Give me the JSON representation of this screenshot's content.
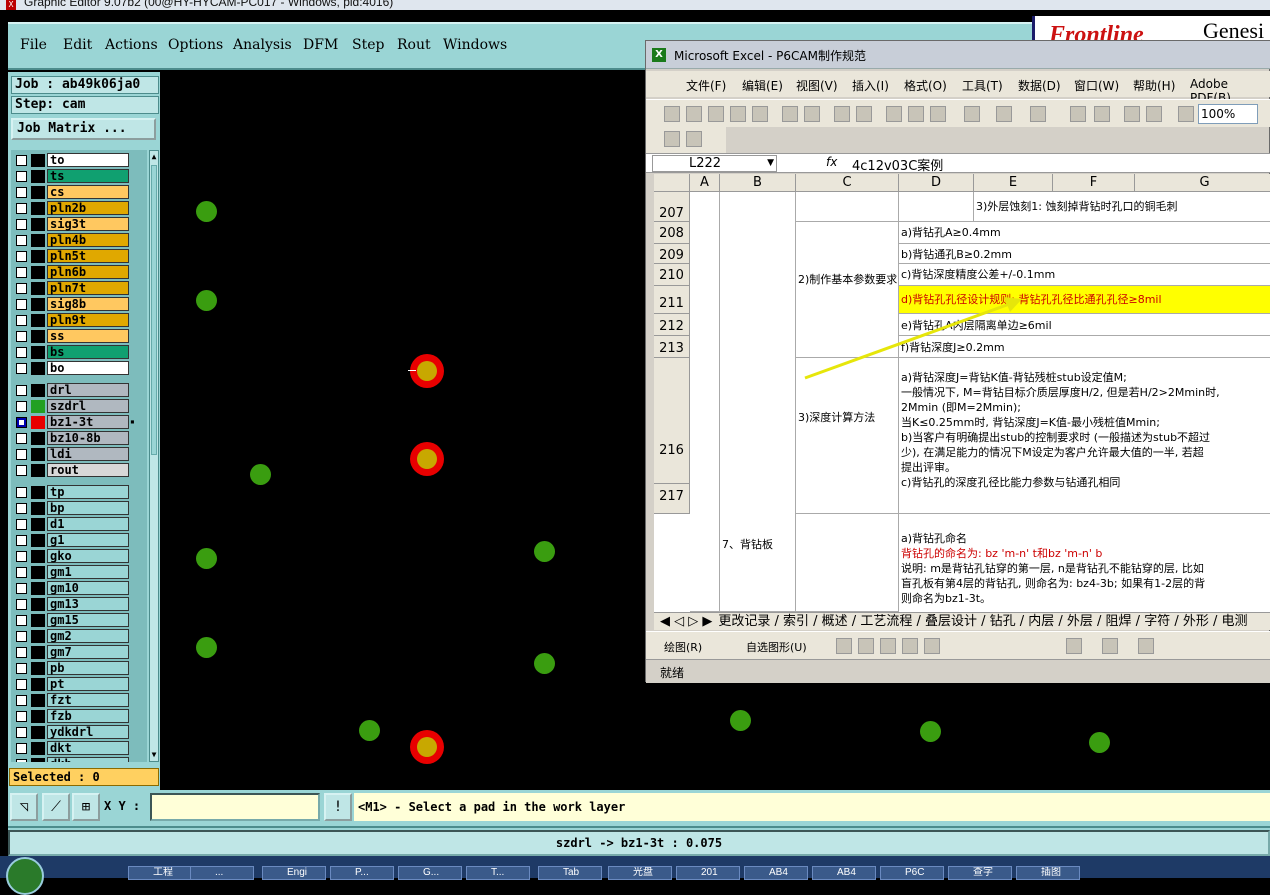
{
  "window": {
    "title": "Graphic Editor 9.07b2 (00@HY-HYCAM-PC017 - Windows, pid:4016)"
  },
  "menu": [
    "File",
    "Edit",
    "Actions",
    "Options",
    "Analysis",
    "DFM",
    "Step",
    "Rout",
    "Windows"
  ],
  "logo": {
    "brand": "Frontline",
    "product": "Genesi"
  },
  "job": {
    "job_label": "Job : ab49k06ja0",
    "step_label": "Step: cam",
    "matrix_button": "Job Matrix ..."
  },
  "layers": [
    {
      "name": "to",
      "color": "#ffffff",
      "swatch": "#000000",
      "checked": false
    },
    {
      "name": "ts",
      "color": "#10a070",
      "swatch": "#000000",
      "checked": false
    },
    {
      "name": "cs",
      "color": "#ffc860",
      "swatch": "#000000",
      "checked": false
    },
    {
      "name": "pln2b",
      "color": "#e0a800",
      "swatch": "#000000",
      "checked": false
    },
    {
      "name": "sig3t",
      "color": "#ffc860",
      "swatch": "#000000",
      "checked": false
    },
    {
      "name": "pln4b",
      "color": "#e0a800",
      "swatch": "#000000",
      "checked": false
    },
    {
      "name": "pln5t",
      "color": "#e0a800",
      "swatch": "#000000",
      "checked": false
    },
    {
      "name": "pln6b",
      "color": "#e0a800",
      "swatch": "#000000",
      "checked": false
    },
    {
      "name": "pln7t",
      "color": "#e0a800",
      "swatch": "#000000",
      "checked": false
    },
    {
      "name": "sig8b",
      "color": "#ffc860",
      "swatch": "#000000",
      "checked": false
    },
    {
      "name": "pln9t",
      "color": "#e0a800",
      "swatch": "#000000",
      "checked": false
    },
    {
      "name": "ss",
      "color": "#ffc860",
      "swatch": "#000000",
      "checked": false
    },
    {
      "name": "bs",
      "color": "#10a070",
      "swatch": "#000000",
      "checked": false
    },
    {
      "name": "bo",
      "color": "#ffffff",
      "swatch": "#000000",
      "checked": false
    },
    {
      "name": "drl",
      "color": "#b0b8c0",
      "swatch": "#000000",
      "checked": false
    },
    {
      "name": "szdrl",
      "color": "#b0b8c0",
      "swatch": "#22a022",
      "checked": false
    },
    {
      "name": "bz1-3t",
      "color": "#b0b8c0",
      "swatch": "#e80000",
      "checked": true
    },
    {
      "name": "bz10-8b",
      "color": "#b0b8c0",
      "swatch": "#000000",
      "checked": false
    },
    {
      "name": "ldi",
      "color": "#b0b8c0",
      "swatch": "#000000",
      "checked": false
    },
    {
      "name": "rout",
      "color": "#d8d8d8",
      "swatch": "#000000",
      "checked": false
    },
    {
      "name": "tp",
      "color": "#9ad5d5",
      "swatch": "#000000",
      "checked": false
    },
    {
      "name": "bp",
      "color": "#9ad5d5",
      "swatch": "#000000",
      "checked": false
    },
    {
      "name": "d1",
      "color": "#9ad5d5",
      "swatch": "#000000",
      "checked": false
    },
    {
      "name": "g1",
      "color": "#9ad5d5",
      "swatch": "#000000",
      "checked": false
    },
    {
      "name": "gko",
      "color": "#9ad5d5",
      "swatch": "#000000",
      "checked": false
    },
    {
      "name": "gm1",
      "color": "#9ad5d5",
      "swatch": "#000000",
      "checked": false
    },
    {
      "name": "gm10",
      "color": "#9ad5d5",
      "swatch": "#000000",
      "checked": false
    },
    {
      "name": "gm13",
      "color": "#9ad5d5",
      "swatch": "#000000",
      "checked": false
    },
    {
      "name": "gm15",
      "color": "#9ad5d5",
      "swatch": "#000000",
      "checked": false
    },
    {
      "name": "gm2",
      "color": "#9ad5d5",
      "swatch": "#000000",
      "checked": false
    },
    {
      "name": "gm7",
      "color": "#9ad5d5",
      "swatch": "#000000",
      "checked": false
    },
    {
      "name": "pb",
      "color": "#9ad5d5",
      "swatch": "#000000",
      "checked": false
    },
    {
      "name": "pt",
      "color": "#9ad5d5",
      "swatch": "#000000",
      "checked": false
    },
    {
      "name": "fzt",
      "color": "#9ad5d5",
      "swatch": "#000000",
      "checked": false
    },
    {
      "name": "fzb",
      "color": "#9ad5d5",
      "swatch": "#000000",
      "checked": false
    },
    {
      "name": "ydkdrl",
      "color": "#9ad5d5",
      "swatch": "#000000",
      "checked": false
    },
    {
      "name": "dkt",
      "color": "#9ad5d5",
      "swatch": "#000000",
      "checked": false
    },
    {
      "name": "dkb",
      "color": "#9ad5d5",
      "swatch": "#000000",
      "checked": false
    }
  ],
  "selected": "Selected : 0",
  "coords": {
    "xy_label": "X Y :",
    "value": ""
  },
  "prompt": "<M1> - Select a pad in the work layer",
  "status": "szdrl -> bz1-3t : 0.075",
  "excel": {
    "title": "Microsoft Excel - P6CAM制作规范",
    "menu": [
      "文件(F)",
      "编辑(E)",
      "视图(V)",
      "插入(I)",
      "格式(O)",
      "工具(T)",
      "数据(D)",
      "窗口(W)",
      "帮助(H)",
      "Adobe PDF(B)"
    ],
    "zoom": "100%",
    "namebox": "L222",
    "fx": "fx",
    "formula": "4c12v03C案例",
    "columns": [
      "A",
      "B",
      "C",
      "D",
      "E",
      "F",
      "G"
    ],
    "rows": [
      "207",
      "208",
      "209",
      "210",
      "211",
      "212",
      "213",
      "216",
      "217"
    ],
    "cells": {
      "r207": "3)外层蚀刻1: 蚀刻掉背钻时孔口的铜毛刺",
      "r208": "a)背钻孔A≥0.4mm",
      "r209": "b)背钻通孔B≥0.2mm",
      "r210": "c)背钻深度精度公差+/-0.1mm",
      "r211": "d)背钻孔孔径设计规则: 背钻孔孔径比通孔孔径≥8mil",
      "r212": "e)背钻孔A内层隔离单边≥6mil",
      "r213": "f)背钻深度J≥0.2mm",
      "c_param": "2)制作基本参数要求",
      "c_depth": "3)深度计算方法",
      "b_board": "7、背钻板",
      "depth_lines": [
        "a)背钻深度J=背钻K值-背钻残桩stub设定值M;",
        "一般情况下, M=背钻目标介质层厚度H/2, 但是若H/2>2Mmin时,",
        "2Mmin (即M=2Mmin);",
        "当K≤0.25mm时, 背钻深度J=K值-最小残桩值Mmin;",
        "b)当客户有明确提出stub的控制要求时 (一般描述为stub不超过",
        "少), 在满足能力的情况下M设定为客户允许最大值的一半, 若超",
        "提出评审。",
        "c)背钻孔的深度孔径比能力参数与钻通孔相同"
      ],
      "naming_lines": [
        "a)背钻孔命名",
        "背钻孔的命名为: bz 'm-n' t和bz 'm-n' b",
        "说明: m是背钻孔钻穿的第一层, n是背钻孔不能钻穿的层, 比如",
        "盲孔板有第4层的背钻孔, 则命名为: bz4-3b; 如果有1-2层的背",
        "则命名为bz1-3t。"
      ]
    },
    "sheet_tabs": "更改记录 / 索引 / 概述 / 工艺流程 / 叠层设计 / 钻孔 / 内层 / 外层 / 阻焊 / 字符 / 外形 / 电测",
    "draw_label": "绘图(R)",
    "autoshape_label": "自选图形(U)",
    "ready": "就绪"
  },
  "taskbar": [
    "工程",
    "...",
    "Engi",
    "P...",
    "G...",
    "T...",
    "Tab",
    "光盘",
    "201",
    "AB4",
    "AB4",
    "P6C",
    "查字",
    "插图"
  ]
}
